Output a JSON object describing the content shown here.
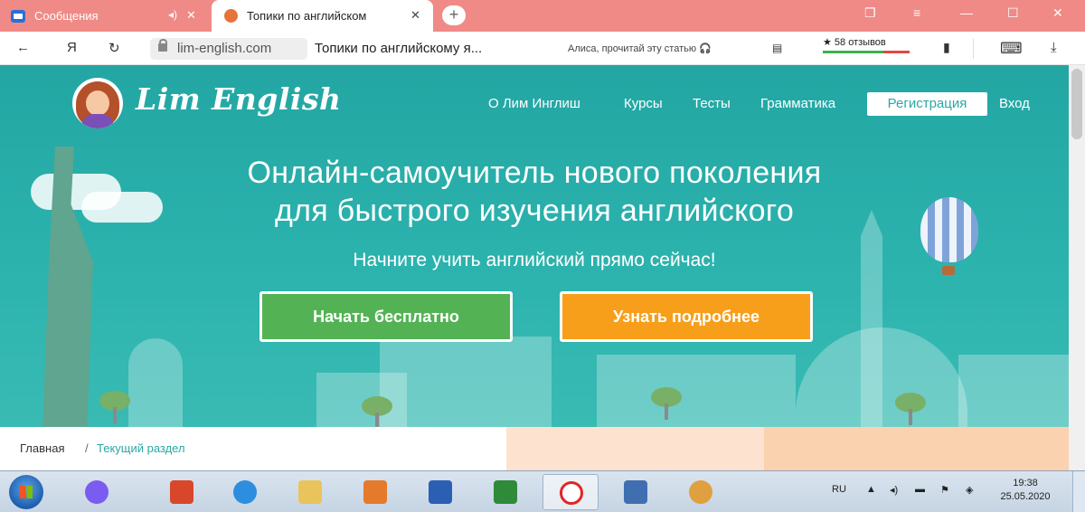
{
  "browser": {
    "tabs": [
      {
        "label": "Сообщения"
      },
      {
        "label": "Топики по английском"
      }
    ],
    "new_tab_symbol": "+",
    "url": "lim-english.com",
    "page_title": "Топики по английскому я...",
    "alisa_text": "Алиса, прочитай эту статью",
    "reviews": "★ 58 отзывов",
    "yandex_letter": "Я"
  },
  "site": {
    "logo_text": "Lim English",
    "nav": {
      "about": "О Лим Инглиш",
      "courses": "Курсы",
      "tests": "Тесты",
      "grammar": "Грамматика",
      "register": "Регистрация",
      "login": "Вход"
    },
    "hero": {
      "title_line1": "Онлайн-самоучитель нового поколения",
      "title_line2": "для быстрого изучения английского",
      "subtitle": "Начните учить английский прямо сейчас!",
      "btn_start": "Начать бесплатно",
      "btn_more": "Узнать подробнее"
    },
    "breadcrumb": {
      "home": "Главная",
      "separator": "/",
      "current": "Текущий раздел"
    }
  },
  "taskbar": {
    "lang": "RU",
    "time": "19:38",
    "date": "25.05.2020"
  },
  "colors": {
    "tabstrip": "#f08a86",
    "hero_teal": "#2cb3ae",
    "btn_green": "#53b354",
    "btn_orange": "#f79f1a",
    "breadcrumb_link": "#2aa8a3"
  }
}
